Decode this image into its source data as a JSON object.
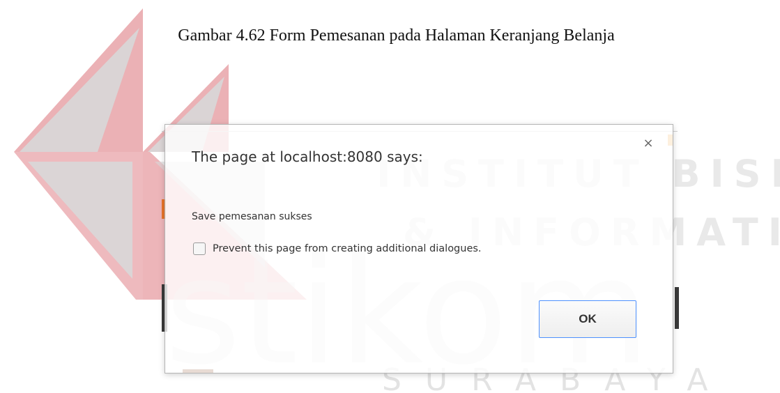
{
  "caption": "Gambar 4.62 Form Pemesanan pada Halaman Keranjang Belanja",
  "dialog": {
    "title": "The page at localhost:8080 says:",
    "message": "Save pemesanan sukses",
    "prevent_label": "Prevent this page from creating additional dialogues.",
    "prevent_checked": false,
    "ok_label": "OK",
    "close_glyph": "×"
  },
  "watermark": {
    "line1": "INSTITUT BISNIS",
    "line2": "& INFORMATIKA",
    "brand": "stikom",
    "city": "SURABAYA",
    "color": "#e8a3a8",
    "gray": "#d8d8d8"
  },
  "colors": {
    "ok_border": "#4d90fe",
    "dialog_border": "#b4b4b4"
  }
}
